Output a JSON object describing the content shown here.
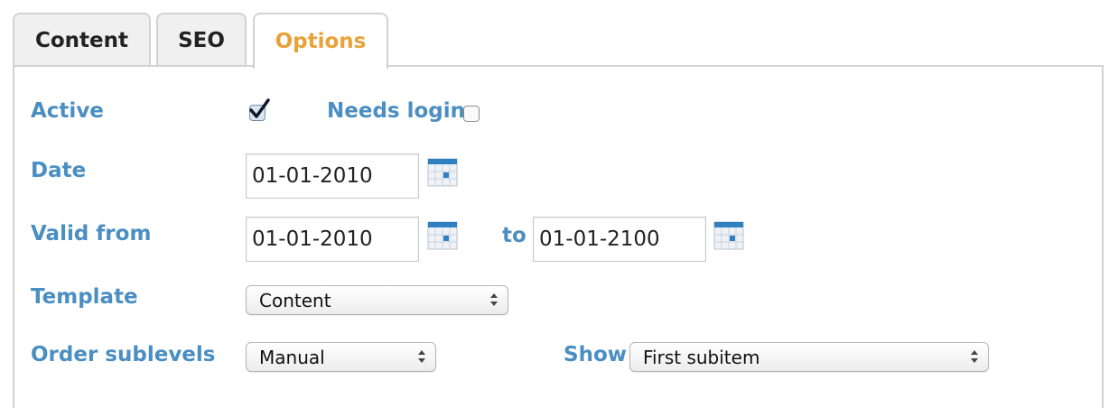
{
  "tabs": [
    {
      "label": "Content",
      "active": false
    },
    {
      "label": "SEO",
      "active": false
    },
    {
      "label": "Options",
      "active": true
    }
  ],
  "form": {
    "active": {
      "label": "Active",
      "checked": true
    },
    "needs_login": {
      "label": "Needs login",
      "checked": false
    },
    "date": {
      "label": "Date",
      "value": "01-01-2010"
    },
    "valid_from": {
      "label": "Valid from",
      "value": "01-01-2010",
      "to_label": "to",
      "to_value": "01-01-2100"
    },
    "template": {
      "label": "Template",
      "selected": "Content"
    },
    "order_sublevels": {
      "label": "Order sublevels",
      "selected": "Manual"
    },
    "show": {
      "label": "Show",
      "selected": "First subitem"
    }
  },
  "icons": {
    "calendar": "calendar-icon",
    "checkmark": "checkmark-icon",
    "select_arrows": "updown-arrows-icon"
  },
  "colors": {
    "label": "#4a8ec2",
    "active_tab": "#e8a23a",
    "tab_text": "#222222"
  }
}
